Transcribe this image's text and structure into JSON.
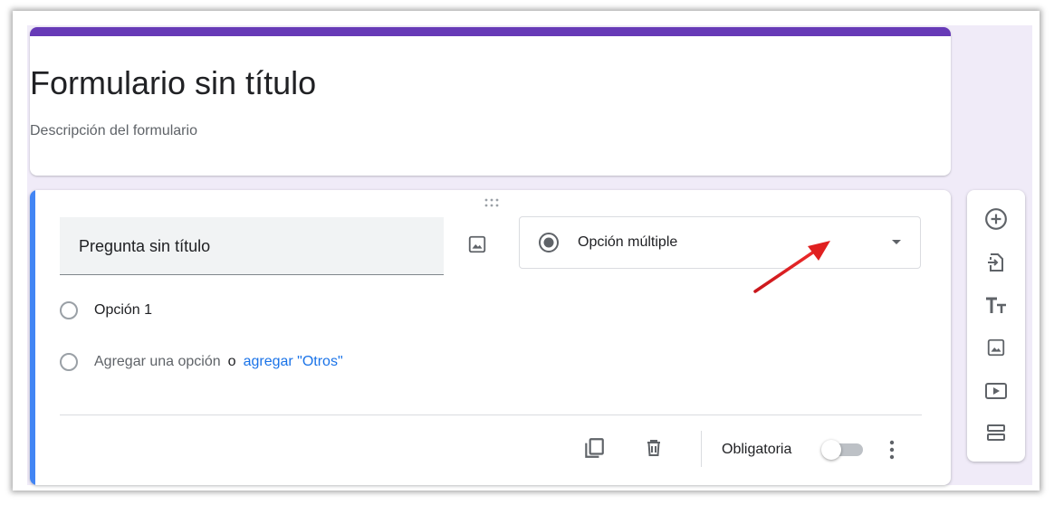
{
  "form": {
    "title": "Formulario sin título",
    "description": "Descripción del formulario"
  },
  "question": {
    "title": "Pregunta sin título",
    "type": {
      "selected": "Opción múltiple",
      "icon": "radio-button-checked-icon"
    },
    "options": [
      {
        "label": "Opción 1"
      }
    ],
    "add_option": {
      "label": "Agregar una opción",
      "or": "o",
      "add_other_label": "agregar \"Otros\""
    },
    "footer": {
      "required_label": "Obligatoria",
      "required": false
    }
  },
  "toolbar": {
    "items": [
      {
        "icon": "add-circle-icon"
      },
      {
        "icon": "import-icon"
      },
      {
        "icon": "title-text-icon",
        "label": "TT"
      },
      {
        "icon": "image-icon"
      },
      {
        "icon": "video-icon"
      },
      {
        "icon": "section-icon"
      }
    ]
  },
  "colors": {
    "accent": "#673ab7",
    "focus": "#4285f4",
    "background": "#f0ebf8",
    "link": "#1a73e8",
    "annotation_arrow": "#e02020"
  }
}
